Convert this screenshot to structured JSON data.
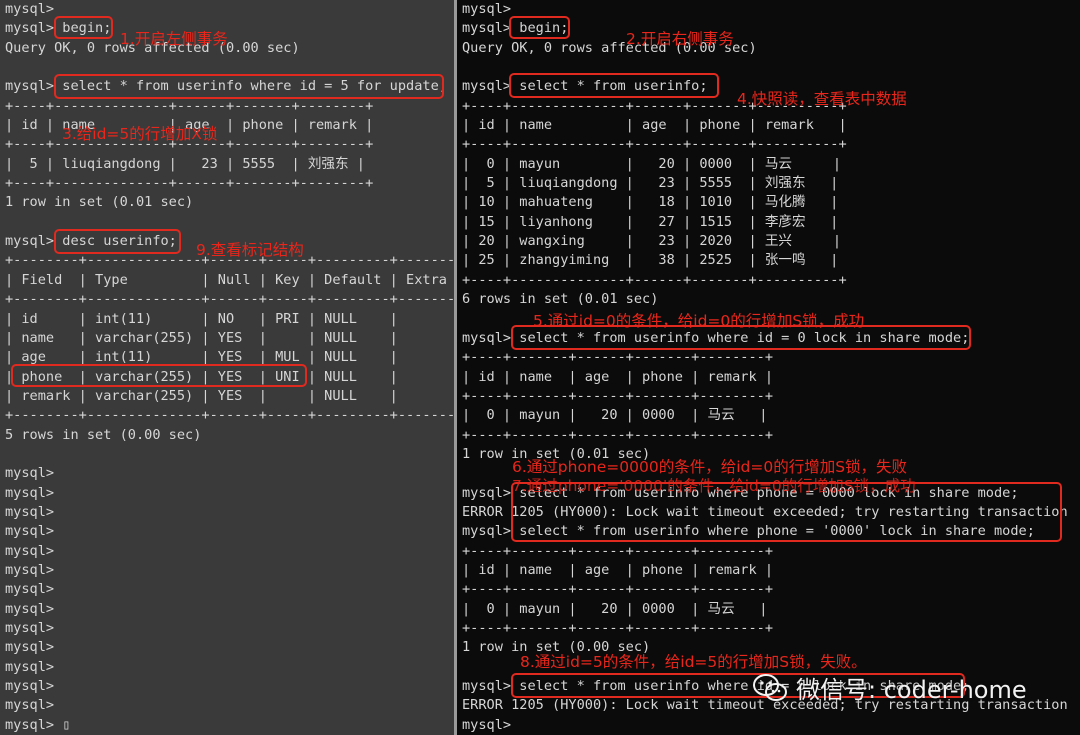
{
  "left_terminal": {
    "lines": [
      "mysql>",
      "mysql> begin;",
      "Query OK, 0 rows affected (0.00 sec)",
      "",
      "mysql> select * from userinfo where id = 5 for update;",
      "+----+--------------+------+-------+--------+",
      "| id | name         | age  | phone | remark |",
      "+----+--------------+------+-------+--------+",
      "|  5 | liuqiangdong |   23 | 5555  | 刘强东 |",
      "+----+--------------+------+-------+--------+",
      "1 row in set (0.01 sec)",
      "",
      "mysql> desc userinfo;",
      "+--------+--------------+------+-----+---------+-------+",
      "| Field  | Type         | Null | Key | Default | Extra |",
      "+--------+--------------+------+-----+---------+-------+",
      "| id     | int(11)      | NO   | PRI | NULL    |       |",
      "| name   | varchar(255) | YES  |     | NULL    |       |",
      "| age    | int(11)      | YES  | MUL | NULL    |       |",
      "| phone  | varchar(255) | YES  | UNI | NULL    |       |",
      "| remark | varchar(255) | YES  |     | NULL    |       |",
      "+--------+--------------+------+-----+---------+-------+",
      "5 rows in set (0.00 sec)",
      "",
      "mysql>",
      "mysql>",
      "mysql>",
      "mysql>",
      "mysql>",
      "mysql>",
      "mysql>",
      "mysql>",
      "mysql>",
      "mysql>",
      "mysql>",
      "mysql>",
      "mysql>",
      "mysql> ▯"
    ]
  },
  "right_terminal": {
    "lines": [
      "mysql>",
      "mysql> begin;",
      "Query OK, 0 rows affected (0.00 sec)",
      "",
      "mysql> select * from userinfo;",
      "+----+--------------+------+-------+----------+",
      "| id | name         | age  | phone | remark   |",
      "+----+--------------+------+-------+----------+",
      "|  0 | mayun        |   20 | 0000  | 马云     |",
      "|  5 | liuqiangdong |   23 | 5555  | 刘强东   |",
      "| 10 | mahuateng    |   18 | 1010  | 马化腾   |",
      "| 15 | liyanhong    |   27 | 1515  | 李彦宏   |",
      "| 20 | wangxing     |   23 | 2020  | 王兴     |",
      "| 25 | zhangyiming  |   38 | 2525  | 张一鸣   |",
      "+----+--------------+------+-------+----------+",
      "6 rows in set (0.01 sec)",
      "",
      "mysql> select * from userinfo where id = 0 lock in share mode;",
      "+----+-------+------+-------+--------+",
      "| id | name  | age  | phone | remark |",
      "+----+-------+------+-------+--------+",
      "|  0 | mayun |   20 | 0000  | 马云   |",
      "+----+-------+------+-------+--------+",
      "1 row in set (0.01 sec)",
      "",
      "mysql> select * from userinfo where phone = 0000 lock in share mode;",
      "ERROR 1205 (HY000): Lock wait timeout exceeded; try restarting transaction",
      "mysql> select * from userinfo where phone = '0000' lock in share mode;",
      "+----+-------+------+-------+--------+",
      "| id | name  | age  | phone | remark |",
      "+----+-------+------+-------+--------+",
      "|  0 | mayun |   20 | 0000  | 马云   |",
      "+----+-------+------+-------+--------+",
      "1 row in set (0.00 sec)",
      "",
      "mysql> select * from userinfo where id = 5 lock in share mode;",
      "ERROR 1205 (HY000): Lock wait timeout exceeded; try restarting transaction",
      "mysql>"
    ]
  },
  "annotations": {
    "left_1": "1.开启左侧事务",
    "left_3": "3.给id=5的行增加X锁",
    "left_9": "9.查看标记结构",
    "right_2": "2.开启右侧事务",
    "right_4": "4.快照读，查看表中数据",
    "right_5": "5.通过id=0的条件，给id=0的行增加S锁，成功",
    "right_6": "6.通过phone=0000的条件，给id=0的行增加S锁，失败",
    "right_7": "7.通过phone='0000'的条件，给id=0的行增加S锁，成功",
    "right_8": "8.通过id=5的条件，给id=5的行增加S锁，失败。"
  },
  "watermark": {
    "text": "微信号: coder-home",
    "icon": "wechat-icon"
  },
  "colors": {
    "annotation": "#e8261b",
    "left_bg": "#3a3a3a",
    "right_bg": "#0b0b0b",
    "text": "#d6d6d6"
  }
}
